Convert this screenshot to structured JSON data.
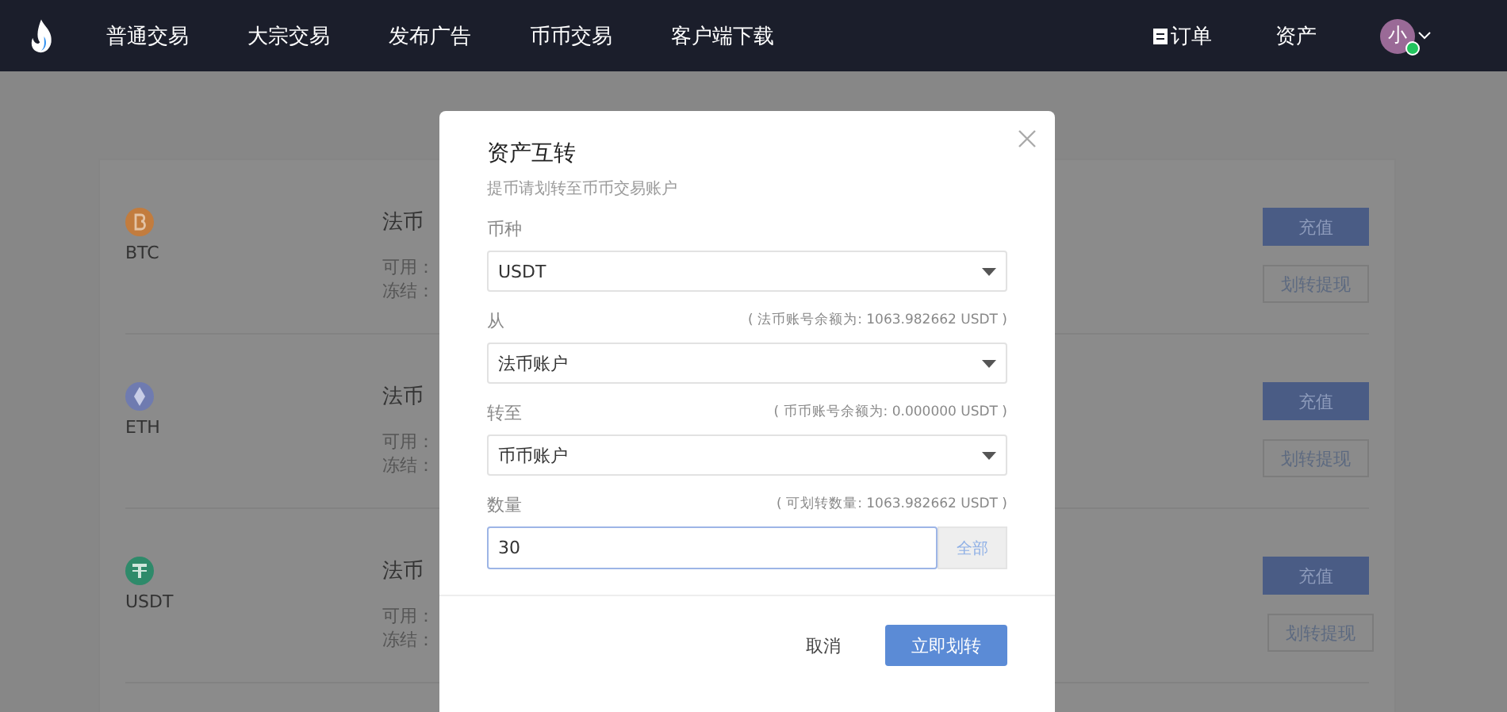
{
  "nav": {
    "items": [
      "普通交易",
      "大宗交易",
      "发布广告",
      "币币交易",
      "客户端下载"
    ],
    "orders": "订单",
    "assets": "资产",
    "avatar": "小"
  },
  "assets": [
    {
      "symbol": "BTC",
      "kind": "btc",
      "color": "#c27c3e",
      "account": "法币",
      "available": "可用：",
      "frozen": "冻结：",
      "deposit": "充值",
      "transfer": "划转提现"
    },
    {
      "symbol": "ETH",
      "kind": "eth",
      "color": "#6f7bb0",
      "account": "法币",
      "available": "可用：",
      "frozen": "冻结：",
      "deposit": "充值",
      "transfer": "划转提现"
    },
    {
      "symbol": "USDT",
      "kind": "usdt",
      "color": "#2e8a6a",
      "account": "法币",
      "available": "可用：",
      "frozen": "冻结：",
      "deposit": "充值",
      "transfer": "划转提现"
    }
  ],
  "modal": {
    "title": "资产互转",
    "subtitle": "提币请划转至币币交易账户",
    "fields": [
      {
        "kind": "select",
        "label": "币种",
        "value": "USDT"
      },
      {
        "kind": "select",
        "label": "从",
        "hint": "( 法币账号余额为:  1063.982662 USDT )",
        "value": "法币账户"
      },
      {
        "kind": "select",
        "label": "转至",
        "hint": "( 币币账号余额为:  0.000000 USDT )",
        "value": "币币账户"
      },
      {
        "kind": "input",
        "label": "数量",
        "hint": "( 可划转数量: 1063.982662 USDT )",
        "value": "30",
        "button": "全部"
      }
    ],
    "cancel": "取消",
    "confirm": "立即划转"
  }
}
